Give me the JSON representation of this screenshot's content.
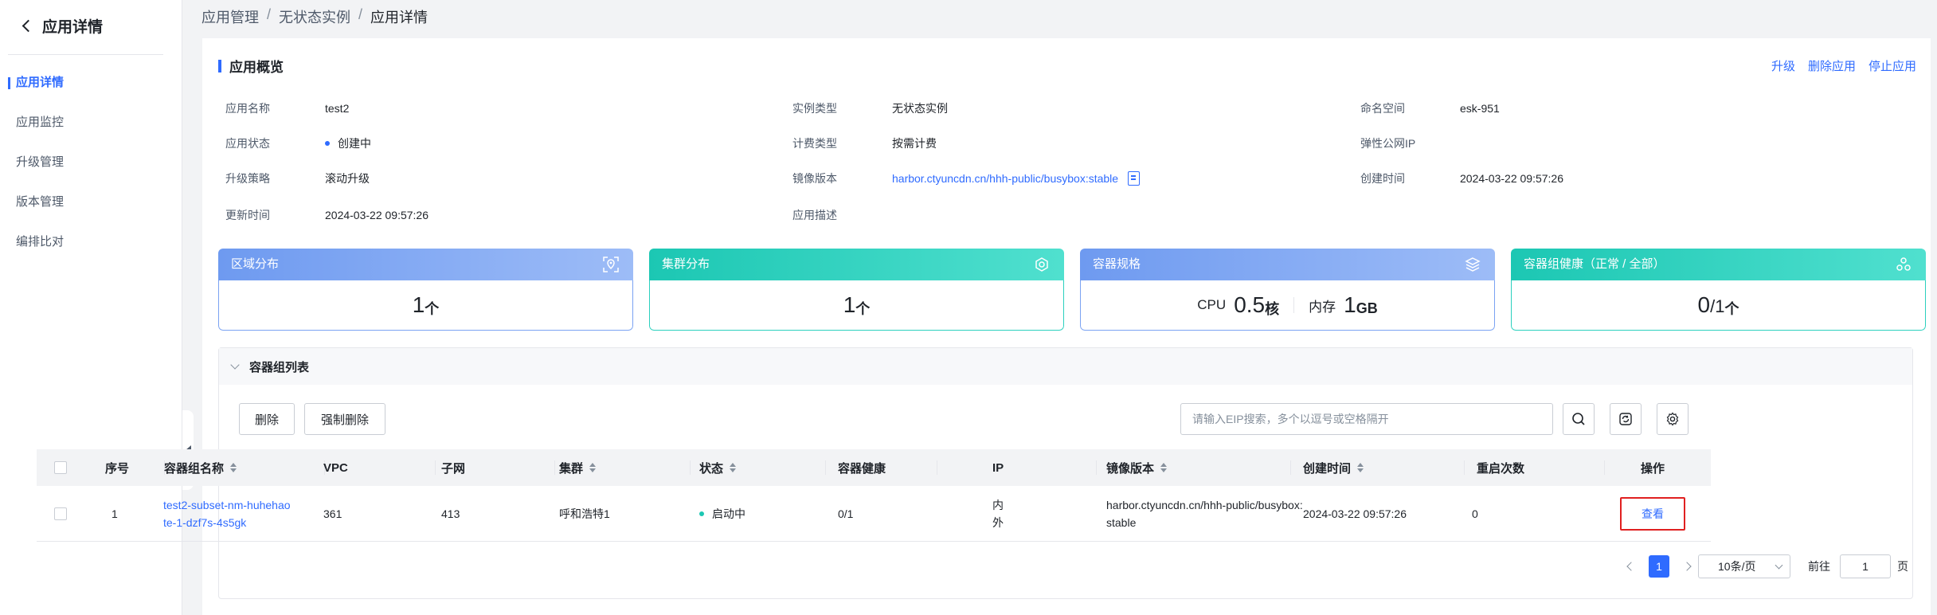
{
  "sidebar": {
    "title": "应用详情",
    "items": [
      {
        "label": "应用详情",
        "active": true
      },
      {
        "label": "应用监控",
        "active": false
      },
      {
        "label": "升级管理",
        "active": false
      },
      {
        "label": "版本管理",
        "active": false
      },
      {
        "label": "编排比对",
        "active": false
      }
    ]
  },
  "breadcrumb": [
    "应用管理",
    "无状态实例",
    "应用详情"
  ],
  "overview": {
    "title": "应用概览",
    "actions": [
      "升级",
      "删除应用",
      "停止应用"
    ],
    "fields": {
      "app_name": {
        "label": "应用名称",
        "value": "test2"
      },
      "instance_type": {
        "label": "实例类型",
        "value": "无状态实例"
      },
      "namespace": {
        "label": "命名空间",
        "value": "esk-951"
      },
      "app_status": {
        "label": "应用状态",
        "value": "创建中"
      },
      "billing_type": {
        "label": "计费类型",
        "value": "按需计费"
      },
      "eip": {
        "label": "弹性公网IP",
        "value": ""
      },
      "upgrade_strategy": {
        "label": "升级策略",
        "value": "滚动升级"
      },
      "image_version": {
        "label": "镜像版本",
        "value": "harbor.ctyuncdn.cn/hhh-public/busybox:stable"
      },
      "created_at": {
        "label": "创建时间",
        "value": "2024-03-22 09:57:26"
      },
      "updated_at": {
        "label": "更新时间",
        "value": "2024-03-22 09:57:26"
      },
      "description": {
        "label": "应用描述",
        "value": ""
      }
    }
  },
  "stats": {
    "region": {
      "title": "区域分布",
      "value": "1",
      "unit": "个"
    },
    "cluster": {
      "title": "集群分布",
      "value": "1",
      "unit": "个"
    },
    "spec": {
      "title": "容器规格",
      "cpu_label": "CPU",
      "cpu_value": "0.5",
      "cpu_unit": "核",
      "mem_label": "内存",
      "mem_value": "1",
      "mem_unit": "GB"
    },
    "health": {
      "title": "容器组健康（正常 / 全部）",
      "healthy": "0",
      "total": "/1",
      "unit": "个"
    }
  },
  "group_list": {
    "title": "容器组列表",
    "buttons": {
      "delete": "删除",
      "force_delete": "强制删除"
    },
    "search_placeholder": "请输入EIP搜索，多个以逗号或空格隔开",
    "columns": [
      "序号",
      "容器组名称",
      "VPC",
      "子网",
      "集群",
      "状态",
      "容器健康",
      "IP",
      "镜像版本",
      "创建时间",
      "重启次数",
      "操作"
    ],
    "rows": [
      {
        "index": "1",
        "name_line1": "test2-subset-nm-huhehao",
        "name_line2": "te-1-dzf7s-4s5gk",
        "vpc": "361",
        "subnet": "413",
        "cluster": "呼和浩特1",
        "status": "启动中",
        "health": "0/1",
        "ip_line1": "内",
        "ip_line2": "外",
        "image_line1": "harbor.ctyuncdn.cn/hhh-public/busybox:",
        "image_line2": "stable",
        "created": "2024-03-22 09:57:26",
        "restarts": "0",
        "action": "查看"
      }
    ],
    "pagination": {
      "current": "1",
      "page_size": "10条/页",
      "goto_label": "前往",
      "goto_value": "1",
      "page_suffix": "页"
    }
  },
  "colors": {
    "accent": "#2f6bff",
    "teal": "#1cc7b3",
    "highlight": "#e02020"
  }
}
